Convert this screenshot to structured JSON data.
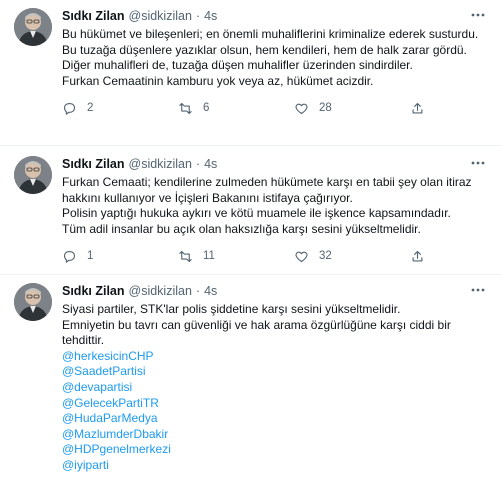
{
  "tweets": [
    {
      "name": "Sıdkı Zilan",
      "handle": "@sidkizilan",
      "dot": "·",
      "time": "4s",
      "lines": [
        "Bu hükümet ve bileşenleri; en önemli muhaliflerini kriminalize ederek susturdu.",
        "Bu tuzağa düşenlere yazıklar olsun, hem kendileri, hem de halk zarar gördü.",
        "Diğer muhalifleri de, tuzağa düşen muhalifler üzerinden sindirdiler.",
        "Furkan Cemaatinin kamburu yok veya az, hükümet acizdir."
      ],
      "replies": "2",
      "retweets": "6",
      "likes": "28"
    },
    {
      "name": "Sıdkı Zilan",
      "handle": "@sidkizilan",
      "dot": "·",
      "time": "4s",
      "lines": [
        "Furkan Cemaati; kendilerine zulmeden hükümete karşı en tabii şey olan itiraz hakkını kullanıyor ve İçişleri Bakanını istifaya çağırıyor.",
        "Polisin yaptığı hukuka aykırı ve kötü muamele ile işkence kapsamındadır.",
        "Tüm adil insanlar bu açık olan haksızlığa karşı sesini yükseltmelidir."
      ],
      "replies": "1",
      "retweets": "11",
      "likes": "32"
    },
    {
      "name": "Sıdkı Zilan",
      "handle": "@sidkizilan",
      "dot": "·",
      "time": "4s",
      "lines": [
        "Siyasi partiler, STK'lar polis şiddetine karşı sesini yükseltmelidir.",
        "Emniyetin bu tavrı can güvenliği ve hak arama özgürlüğüne karşı ciddi bir tehdittir."
      ],
      "mentions": [
        "@herkesicinCHP",
        "@SaadetPartisi",
        "@devapartisi",
        "@GelecekPartiTR",
        "@HudaParMedya",
        "@MazlumderDbakir",
        "@HDPgenelmerkezi",
        "@iyiparti"
      ]
    }
  ],
  "icons": {
    "more": "more-dots-icon",
    "reply": "reply-icon",
    "retweet": "retweet-icon",
    "like": "heart-icon",
    "share": "share-icon"
  },
  "colors": {
    "text": "#0f1419",
    "secondary": "#536471",
    "link": "#1d9bf0",
    "divider": "#eff3f4"
  }
}
